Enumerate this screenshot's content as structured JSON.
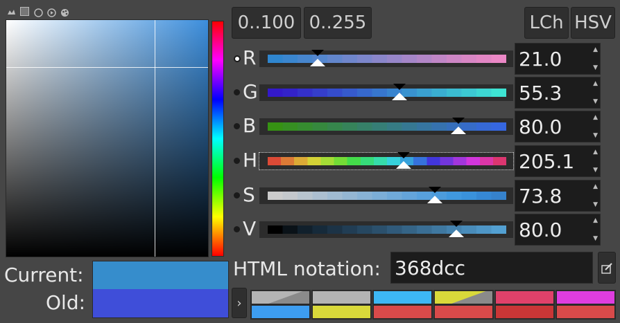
{
  "toolbar_icons": [
    "gimp-icon",
    "cmyk-icon",
    "watercolor-icon",
    "wheel-icon",
    "palette-icon"
  ],
  "range_buttons": [
    "0..100",
    "0..255"
  ],
  "mode_buttons": [
    "LCh",
    "HSV"
  ],
  "channels": [
    {
      "label": "R",
      "value": "21.0",
      "fraction": 0.21,
      "selected": true,
      "track": [
        "#2f86cf",
        "#3a86cf",
        "#4786ce",
        "#5486cd",
        "#6286cc",
        "#6f86cc",
        "#7c86cb",
        "#8a86ca",
        "#9786c9",
        "#a586c8",
        "#b286c7",
        "#c086c6",
        "#cd86c5",
        "#d886c4",
        "#e286c4",
        "#eb88c6"
      ]
    },
    {
      "label": "G",
      "value": "55.3",
      "fraction": 0.553,
      "selected": false,
      "track": [
        "#3319c9",
        "#3322c9",
        "#3430ca",
        "#353ecb",
        "#354ccc",
        "#365acd",
        "#3668cd",
        "#3776ce",
        "#3884cf",
        "#3992cf",
        "#3aa0d0",
        "#3aaed1",
        "#3bbcd1",
        "#3cc8d2",
        "#3dd6d2",
        "#3ee4d3"
      ]
    },
    {
      "label": "B",
      "value": "80.0",
      "fraction": 0.8,
      "selected": false,
      "track": [
        "#369213",
        "#368f22",
        "#368c30",
        "#36893e",
        "#36864c",
        "#36835a",
        "#368068",
        "#367e76",
        "#367b84",
        "#367892",
        "#3675a0",
        "#3672ae",
        "#366fbc",
        "#366cc8",
        "#3669d6",
        "#3667e0"
      ]
    },
    {
      "label": "H",
      "value": "205.1",
      "fraction": 0.57,
      "selected": false,
      "track": [
        "#dc4a36",
        "#dc7a36",
        "#dcaa36",
        "#d4d236",
        "#a4dc36",
        "#74dc36",
        "#44dc4a",
        "#36dc7a",
        "#36dcaa",
        "#36d2dc",
        "#36a2dc",
        "#3672dc",
        "#4236dc",
        "#7236dc",
        "#a236dc",
        "#d236dc",
        "#dc36a8",
        "#dc3670"
      ]
    },
    {
      "label": "S",
      "value": "73.8",
      "fraction": 0.7,
      "selected": false,
      "track": [
        "#cccccc",
        "#c4c8cc",
        "#b8c4ce",
        "#acbfd0",
        "#a0bbd2",
        "#94b6d3",
        "#88b2d5",
        "#7caed7",
        "#70a9d8",
        "#64a4da",
        "#58a0dc",
        "#4c9cdd",
        "#4098df",
        "#3a92dc",
        "#3688d4",
        "#3682cc"
      ]
    },
    {
      "label": "V",
      "value": "80.0",
      "fraction": 0.79,
      "selected": false,
      "track": [
        "#000000",
        "#0a1218",
        "#11202c",
        "#162a3a",
        "#1c3346",
        "#213d54",
        "#264760",
        "#2b506c",
        "#305a7a",
        "#356486",
        "#3a6e94",
        "#3f78a0",
        "#4482ae",
        "#498cba",
        "#4e96c6",
        "#53a0d2"
      ]
    }
  ],
  "current_label": "Current:",
  "old_label": "Old:",
  "current_color": "#368dcc",
  "old_color": "#3f4ed9",
  "html_notation_label": "HTML notation:",
  "html_value": "368dcc",
  "history_toggle": "›",
  "history_top": [
    "#b4b4b4",
    "#b4b4b4",
    "#3db8f5",
    "#d9d93a",
    "#e0416a",
    "#e03de0"
  ],
  "history_bottom": [
    "#3d9df0",
    "#d9d93a",
    "#d84a4a",
    "#d84a4a",
    "#c93636",
    "#d84a4a"
  ]
}
